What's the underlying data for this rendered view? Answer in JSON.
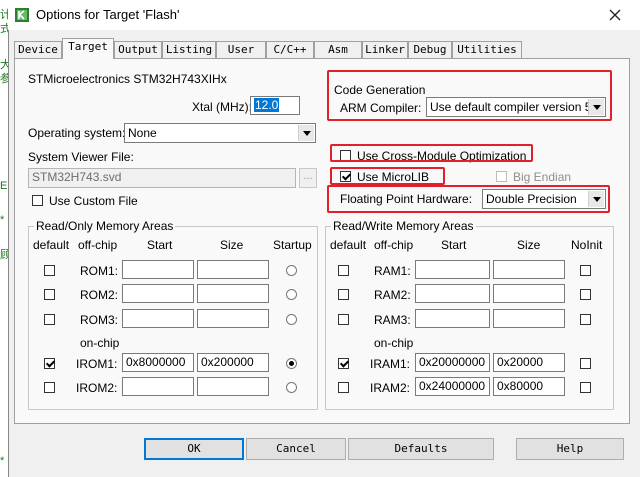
{
  "window": {
    "title": "Options for Target 'Flash'"
  },
  "left_strip": [
    "计",
    "式",
    "大",
    "参",
    "E",
    "*",
    "顾",
    "*"
  ],
  "tabs": [
    "Device",
    "Target",
    "Output",
    "Listing",
    "User",
    "C/C++",
    "Asm",
    "Linker",
    "Debug",
    "Utilities"
  ],
  "target": {
    "device_name": "STMicroelectronics STM32H743XIHx",
    "xtal_label": "Xtal (MHz):",
    "xtal_value": "12.0",
    "os_label": "Operating system:",
    "os_value": "None",
    "svf_label": "System Viewer File:",
    "svf_value": "STM32H743.svd",
    "svf_browse": "...",
    "use_custom_file": "Use Custom File"
  },
  "codegen": {
    "group_label": "Code Generation",
    "arm_compiler_label": "ARM Compiler:",
    "arm_compiler_value": "Use default compiler version 5",
    "cross_module": "Use Cross-Module Optimization",
    "microlib": "Use MicroLIB",
    "big_endian": "Big Endian",
    "fph_label": "Floating Point Hardware:",
    "fph_value": "Double Precision"
  },
  "rom": {
    "group_label": "Read/Only Memory Areas",
    "headers": {
      "default": "default",
      "offchip": "off-chip",
      "start": "Start",
      "size": "Size",
      "startup": "Startup"
    },
    "onchip_label": "on-chip",
    "rows": [
      {
        "name": "ROM1:",
        "start": "",
        "size": ""
      },
      {
        "name": "ROM2:",
        "start": "",
        "size": ""
      },
      {
        "name": "ROM3:",
        "start": "",
        "size": ""
      },
      {
        "name": "IROM1:",
        "start": "0x8000000",
        "size": "0x200000"
      },
      {
        "name": "IROM2:",
        "start": "",
        "size": ""
      }
    ]
  },
  "ram": {
    "group_label": "Read/Write Memory Areas",
    "headers": {
      "default": "default",
      "offchip": "off-chip",
      "start": "Start",
      "size": "Size",
      "noinit": "NoInit"
    },
    "onchip_label": "on-chip",
    "rows": [
      {
        "name": "RAM1:",
        "start": "",
        "size": ""
      },
      {
        "name": "RAM2:",
        "start": "",
        "size": ""
      },
      {
        "name": "RAM3:",
        "start": "",
        "size": ""
      },
      {
        "name": "IRAM1:",
        "start": "0x20000000",
        "size": "0x20000"
      },
      {
        "name": "IRAM2:",
        "start": "0x24000000",
        "size": "0x80000"
      }
    ]
  },
  "buttons": {
    "ok": "OK",
    "cancel": "Cancel",
    "defaults": "Defaults",
    "help": "Help"
  },
  "colors": {
    "highlight_box": "#e0202a",
    "selection": "#0078d7"
  }
}
